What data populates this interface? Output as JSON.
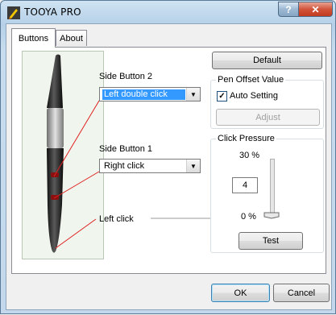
{
  "window": {
    "title": "TOOYA PRO",
    "help_glyph": "?",
    "close_glyph": "✕"
  },
  "tabs": [
    {
      "label": "Buttons",
      "active": true
    },
    {
      "label": "About",
      "active": false
    }
  ],
  "buttons_tab": {
    "side_button_2": {
      "label": "Side Button 2",
      "value": "Left double click"
    },
    "side_button_1": {
      "label": "Side Button 1",
      "value": "Right click"
    },
    "tip_label": "Left click",
    "default_label": "Default",
    "pen_offset": {
      "legend": "Pen Offset Value",
      "auto_setting_label": "Auto Setting",
      "auto_setting_checked": true,
      "check_glyph": "✓",
      "adjust_label": "Adjust"
    },
    "click_pressure": {
      "legend": "Click Pressure",
      "max_label": "30 %",
      "min_label": "0 %",
      "value": "4",
      "test_label": "Test"
    }
  },
  "footer": {
    "ok_label": "OK",
    "cancel_label": "Cancel"
  },
  "icons": {
    "app": "pen-app-icon",
    "dropdown": "chevron-down-icon"
  },
  "colors": {
    "selection": "#3399ff",
    "callout_lines": "#e02020",
    "close_button": "#c23a1f"
  }
}
